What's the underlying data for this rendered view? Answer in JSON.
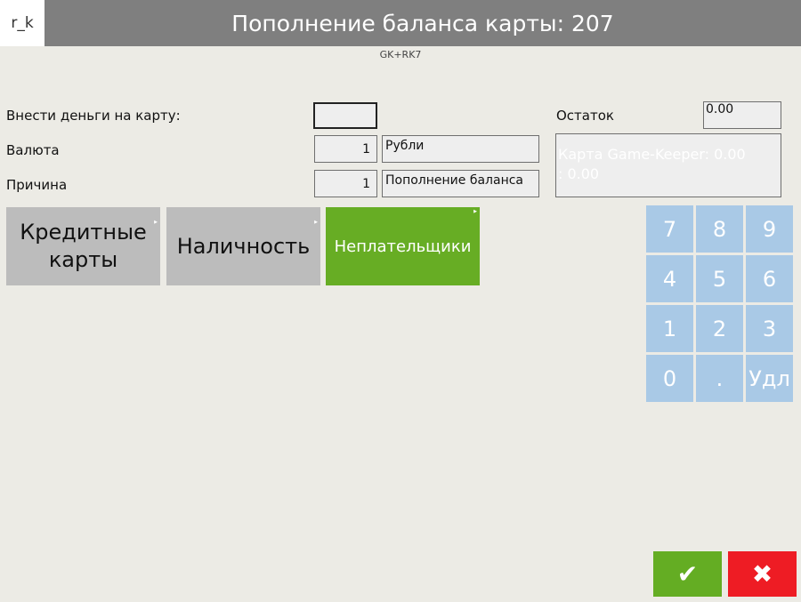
{
  "header": {
    "logo": "r_k",
    "title": "Пополнение баланса карты: 207",
    "subtitle": "GK+RK7"
  },
  "form": {
    "deposit_label": "Внести деньги на карту:",
    "deposit_value": "",
    "currency_label": "Валюта",
    "currency_code": "1",
    "currency_name": "Рубли",
    "reason_label": "Причина",
    "reason_code": "1",
    "reason_name": "Пополнение баланса",
    "balance_label": "Остаток",
    "balance_value": "0.00",
    "info_line1": "Карта Game-Keeper: 0.00",
    "info_line2": ": 0.00"
  },
  "payment_buttons": [
    {
      "label": "Кредитные карты",
      "style": "gray"
    },
    {
      "label": "Наличность",
      "style": "gray"
    },
    {
      "label": "Неплательщики",
      "style": "green"
    }
  ],
  "keypad": [
    "7",
    "8",
    "9",
    "4",
    "5",
    "6",
    "1",
    "2",
    "3",
    "0",
    ".",
    "Удл"
  ],
  "actions": {
    "ok_icon": "check-icon",
    "ok_symbol": "✔",
    "cancel_icon": "close-icon",
    "cancel_symbol": "✖"
  },
  "colors": {
    "title_bar": "#7f7f7f",
    "green": "#67ad24",
    "red": "#ee1c24",
    "keypad": "#a9c9e6",
    "gray_button": "#bcbcbc"
  }
}
